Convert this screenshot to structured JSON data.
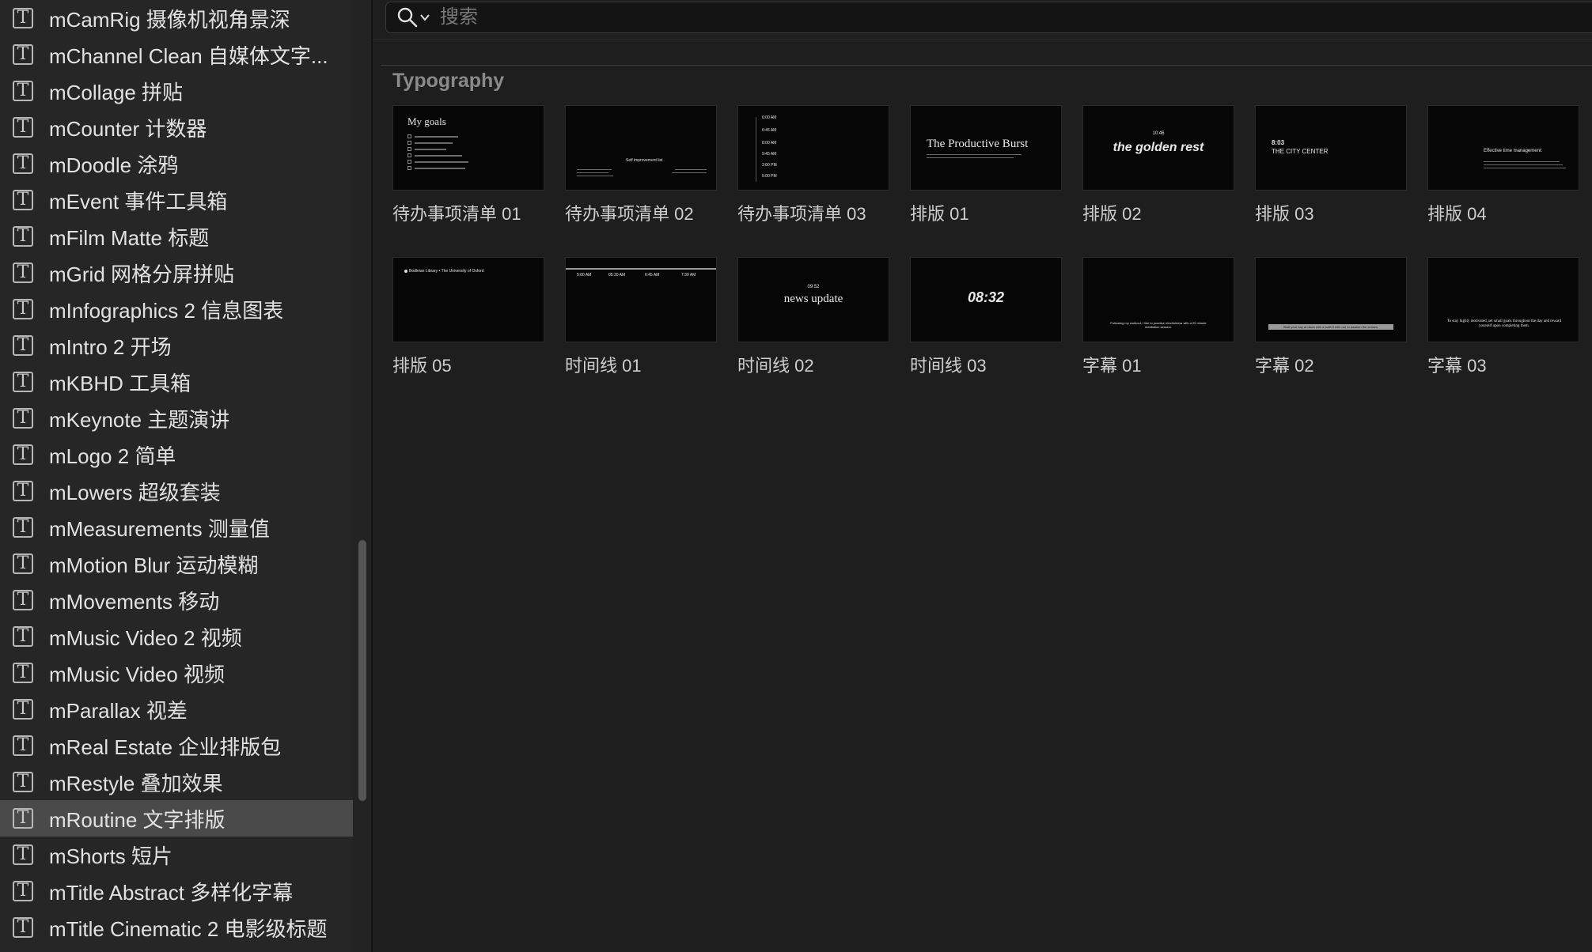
{
  "sidebar": {
    "selected_index": 22,
    "icon": "text-template-icon",
    "items": [
      {
        "label": "mCamRig 摄像机视角景深"
      },
      {
        "label": "mChannel Clean 自媒体文字..."
      },
      {
        "label": "mCollage 拼贴"
      },
      {
        "label": "mCounter 计数器"
      },
      {
        "label": "mDoodle 涂鸦"
      },
      {
        "label": "mEvent 事件工具箱"
      },
      {
        "label": "mFilm Matte 标题"
      },
      {
        "label": "mGrid 网格分屏拼贴"
      },
      {
        "label": "mInfographics 2 信息图表"
      },
      {
        "label": "mIntro 2 开场"
      },
      {
        "label": "mKBHD 工具箱"
      },
      {
        "label": "mKeynote 主题演讲"
      },
      {
        "label": "mLogo 2 简单"
      },
      {
        "label": "mLowers 超级套装"
      },
      {
        "label": "mMeasurements 测量值"
      },
      {
        "label": "mMotion Blur 运动模糊"
      },
      {
        "label": "mMovements 移动"
      },
      {
        "label": "mMusic Video 2 视频"
      },
      {
        "label": "mMusic Video 视频"
      },
      {
        "label": "mParallax 视差"
      },
      {
        "label": "mReal Estate 企业排版包"
      },
      {
        "label": "mRestyle 叠加效果"
      },
      {
        "label": "mRoutine 文字排版"
      },
      {
        "label": "mShorts 短片"
      },
      {
        "label": "mTitle Abstract 多样化字幕"
      },
      {
        "label": "mTitle Cinematic 2 电影级标题"
      }
    ]
  },
  "search": {
    "placeholder": "搜索",
    "value": ""
  },
  "section": {
    "title": "Typography"
  },
  "tiles": [
    {
      "label": "待办事项清单 01",
      "thumb": {
        "heading": "My goals"
      }
    },
    {
      "label": "待办事项清单 02",
      "thumb": {
        "heading": "Self improvement list"
      }
    },
    {
      "label": "待办事项清单 03",
      "thumb": {
        "times": [
          "6:00 AM",
          "6:45 AM",
          "8:00 AM",
          "9:45 AM",
          "3:00 PM",
          "5:00 PM"
        ]
      }
    },
    {
      "label": "排版 01",
      "thumb": {
        "heading": "The Productive Burst"
      }
    },
    {
      "label": "排版 02",
      "thumb": {
        "time": "10:46",
        "heading": "the golden rest"
      }
    },
    {
      "label": "排版 03",
      "thumb": {
        "time": "8:03",
        "heading": "THE CITY CENTER"
      }
    },
    {
      "label": "排版 04",
      "thumb": {
        "heading": "Effective time management:"
      }
    },
    {
      "label": "排版 05",
      "thumb": {
        "heading": "Bodleian Library  •  The University of Oxford"
      }
    },
    {
      "label": "时间线 01",
      "thumb": {
        "times": [
          "5:00 AM",
          "05:30 AM",
          "6:45 AM",
          "7:30 AM"
        ]
      }
    },
    {
      "label": "时间线 02",
      "thumb": {
        "time": "09:52",
        "heading": "news update"
      }
    },
    {
      "label": "时间线 03",
      "thumb": {
        "heading": "08:32"
      }
    },
    {
      "label": "字幕 01",
      "thumb": {
        "heading": "Following my workout, I like to practice mindfulness with a 20 minute meditation session."
      }
    },
    {
      "label": "字幕 02",
      "thumb": {
        "heading": "Start your day at dawn with a swift 5 mile run to awaken the senses."
      }
    },
    {
      "label": "字幕 03",
      "thumb": {
        "heading": "To stay highly motivated, set small goals throughout the day and reward yourself upon completing them."
      }
    }
  ],
  "colors": {
    "background": "#1e1e1e",
    "sidebar": "#262626",
    "selected": "#4a4a4a"
  }
}
